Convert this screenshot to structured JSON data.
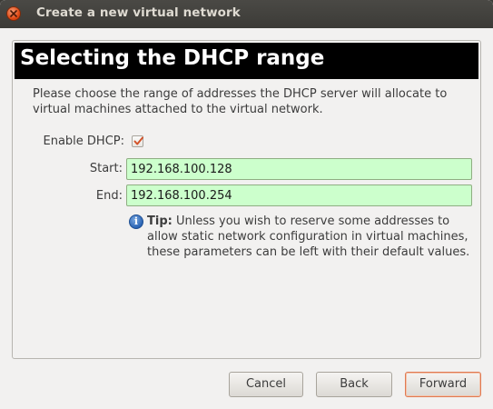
{
  "window": {
    "title": "Create a new virtual network"
  },
  "header": {
    "title": "Selecting the DHCP range"
  },
  "description": "Please choose the range of addresses the DHCP server will allocate to virtual machines attached to the virtual network.",
  "form": {
    "enable_dhcp_label": "Enable DHCP:",
    "enable_dhcp_checked": true,
    "start_label": "Start:",
    "start_value": "192.168.100.128",
    "end_label": "End:",
    "end_value": "192.168.100.254"
  },
  "tip": {
    "label": "Tip:",
    "text": " Unless you wish to reserve some addresses to allow static network configuration in virtual machines, these parameters can be left with their default values."
  },
  "buttons": {
    "cancel": "Cancel",
    "back": "Back",
    "forward": "Forward"
  },
  "colors": {
    "input_valid_bg": "#ccffcc",
    "header_bg": "#000000",
    "close_button": "#df4a16",
    "default_button_border": "#e07a52"
  },
  "icons": {
    "close": "close-icon",
    "checkbox_check": "checkmark-icon",
    "tip": "info-icon"
  }
}
